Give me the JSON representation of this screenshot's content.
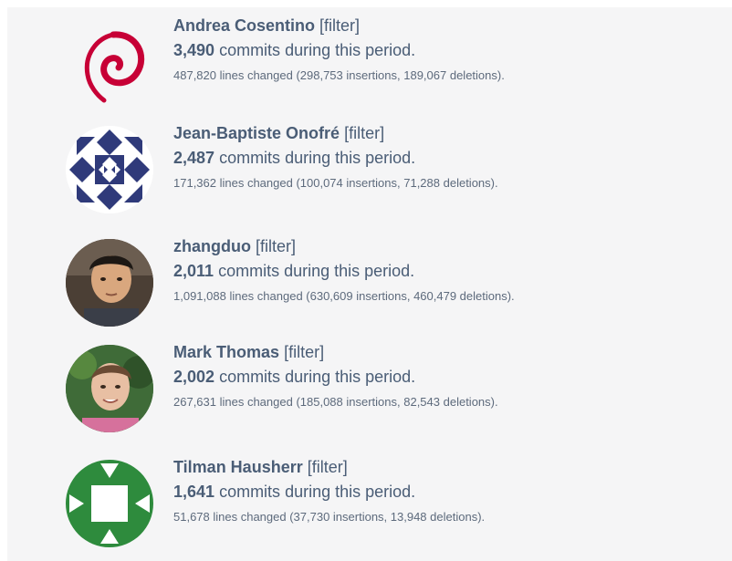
{
  "contributors": [
    {
      "name": "Andrea Cosentino",
      "filter_label": "[filter]",
      "commits": "3,490",
      "commits_suffix": "commits during this period.",
      "lines_text": "487,820 lines changed (298,753 insertions, 189,067 deletions).",
      "avatar": "debian-swirl-icon"
    },
    {
      "name": "Jean-Baptiste Onofré",
      "filter_label": "[filter]",
      "commits": "2,487",
      "commits_suffix": "commits during this period.",
      "lines_text": "171,362 lines changed (100,074 insertions, 71,288 deletions).",
      "avatar": "navy-geometric-identicon"
    },
    {
      "name": "zhangduo",
      "filter_label": "[filter]",
      "commits": "2,011",
      "commits_suffix": "commits during this period.",
      "lines_text": "1,091,088 lines changed (630,609 insertions, 460,479 deletions).",
      "avatar": "user-photo"
    },
    {
      "name": "Mark Thomas",
      "filter_label": "[filter]",
      "commits": "2,002",
      "commits_suffix": "commits during this period.",
      "lines_text": "267,631 lines changed (185,088 insertions, 82,543 deletions).",
      "avatar": "user-photo"
    },
    {
      "name": "Tilman Hausherr",
      "filter_label": "[filter]",
      "commits": "1,641",
      "commits_suffix": "commits during this period.",
      "lines_text": "51,678 lines changed (37,730 insertions, 13,948 deletions).",
      "avatar": "green-geometric-identicon"
    }
  ],
  "colors": {
    "text": "#4a5d76",
    "subtext": "#5d6a7c",
    "panel_bg": "#f5f5f6",
    "debian_red": "#c70036",
    "identicon_navy": "#2f3a7a",
    "identicon_green": "#2e8b3d"
  }
}
